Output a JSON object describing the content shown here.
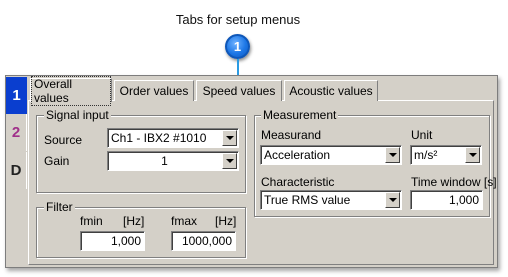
{
  "annotation": {
    "caption": "Tabs for setup menus",
    "callout_number": "1"
  },
  "side_tabs": [
    "1",
    "2",
    "D"
  ],
  "tabs": [
    "Overall values",
    "Order values",
    "Speed values",
    "Acoustic values"
  ],
  "signal_input": {
    "title": "Signal input",
    "source_label": "Source",
    "source_value": "Ch1 - IBX2 #1010",
    "gain_label": "Gain",
    "gain_value": "1"
  },
  "filter": {
    "title": "Filter",
    "fmin_label": "fmin",
    "fmin_unit": "[Hz]",
    "fmin_value": "1,000",
    "fmax_label": "fmax",
    "fmax_unit": "[Hz]",
    "fmax_value": "1000,000"
  },
  "measurement": {
    "title": "Measurement",
    "measurand_label": "Measurand",
    "measurand_value": "Acceleration",
    "unit_label": "Unit",
    "unit_value": "m/s²",
    "characteristic_label": "Characteristic",
    "characteristic_value": "True RMS value",
    "time_window_label": "Time window [s]",
    "time_window_value": "1,000"
  }
}
